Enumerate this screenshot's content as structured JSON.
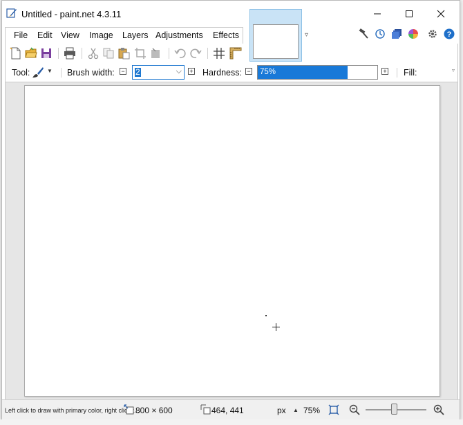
{
  "window": {
    "title": "Untitled - paint.net 4.3.11"
  },
  "menu": [
    "File",
    "Edit",
    "View",
    "Image",
    "Layers",
    "Adjustments",
    "Effects"
  ],
  "tool_options": {
    "tool_label": "Tool:",
    "brush_width_label": "Brush width:",
    "brush_width_value": "2",
    "hardness_label": "Hardness:",
    "hardness_value": "75%",
    "hardness_fraction": 0.75,
    "fill_label": "Fill:"
  },
  "statusbar": {
    "hint": "Left click to draw with primary color, right click t...",
    "image_size": "800 × 600",
    "cursor_position": "464, 441",
    "units": "px",
    "zoom": "75%"
  },
  "colors": {
    "accent": "#1879d8",
    "tab_highlight": "#c9e3f6",
    "canvas": "#ffffff",
    "workspace": "#e6e6e6"
  }
}
